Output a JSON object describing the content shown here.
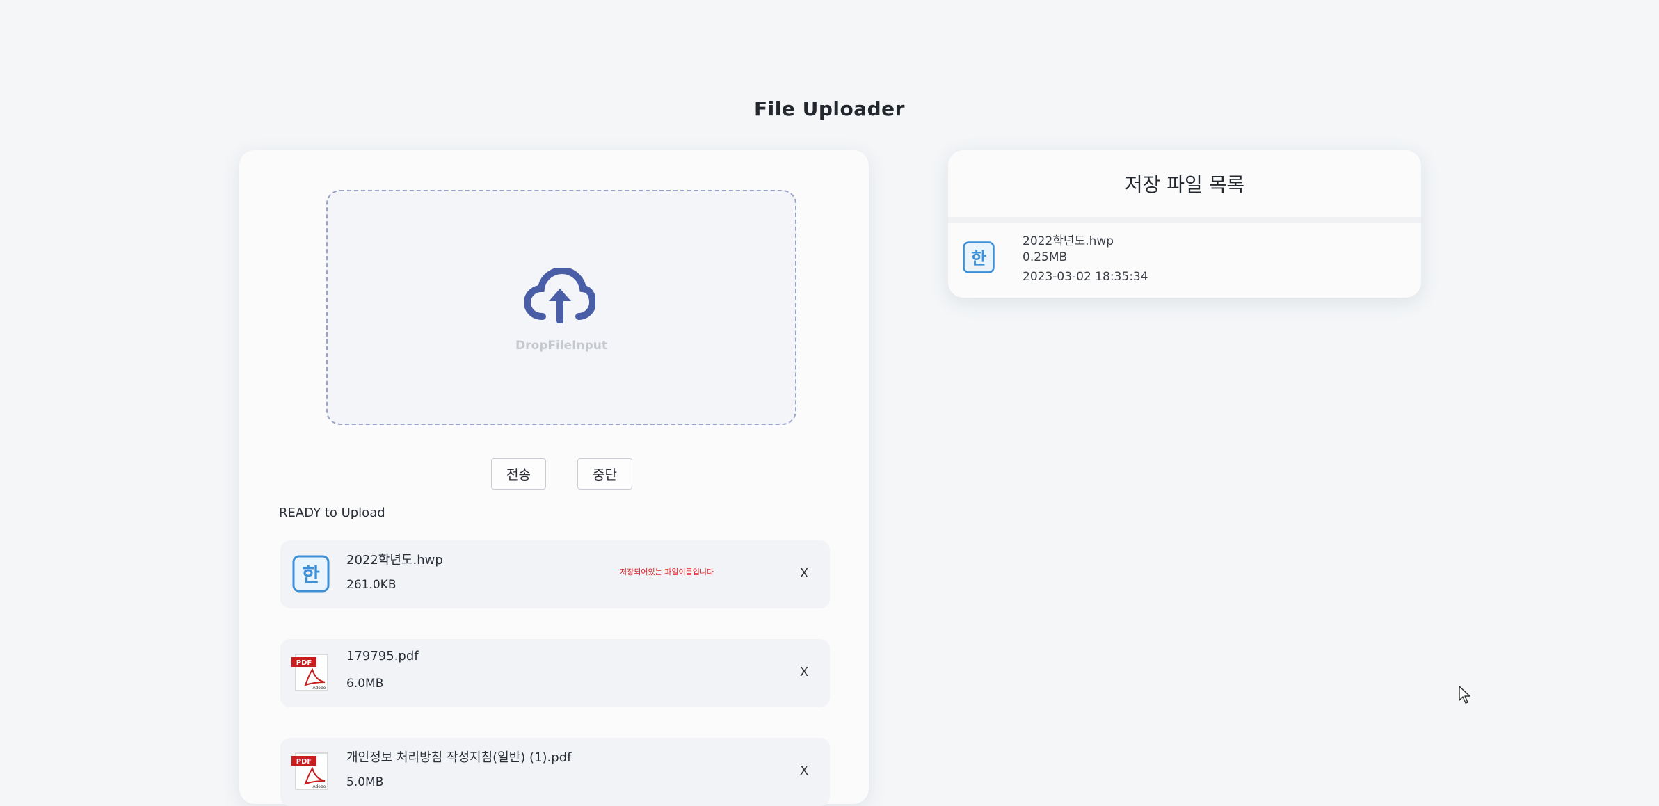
{
  "app": {
    "title": "File Uploader"
  },
  "dropzone": {
    "label": "DropFileInput",
    "icon": "cloud-upload-icon"
  },
  "actions": {
    "send_label": "전송",
    "stop_label": "중단"
  },
  "upload_list": {
    "title": "READY to Upload",
    "items": [
      {
        "name": "2022학년도.hwp",
        "size": "261.0KB",
        "icon": "hwp-file-icon",
        "warning": "저장되어있는 파일이름입니다",
        "remove_label": "X"
      },
      {
        "name": "179795.pdf",
        "size": "6.0MB",
        "icon": "pdf-file-icon",
        "remove_label": "X"
      },
      {
        "name": "개인정보 처리방침 작성지침(일반) (1).pdf",
        "size": "5.0MB",
        "icon": "pdf-file-icon",
        "remove_label": "X"
      }
    ]
  },
  "stored": {
    "title": "저장 파일 목록",
    "items": [
      {
        "name": "2022학년도.hwp",
        "size": "0.25MB",
        "date": "2023-03-02 18:35:34",
        "icon": "hwp-file-icon"
      }
    ]
  },
  "colors": {
    "background": "#f4f6f8",
    "panel": "#fbfbfb",
    "accent": "#4a5ea8",
    "warning": "#e02424",
    "hwp_icon": "#3d8fd6",
    "pdf_icon": "#c81e1e"
  },
  "pdf_icon_text": {
    "top": "PDF",
    "bottom": "Adobe"
  },
  "hwp_icon_text": "한"
}
